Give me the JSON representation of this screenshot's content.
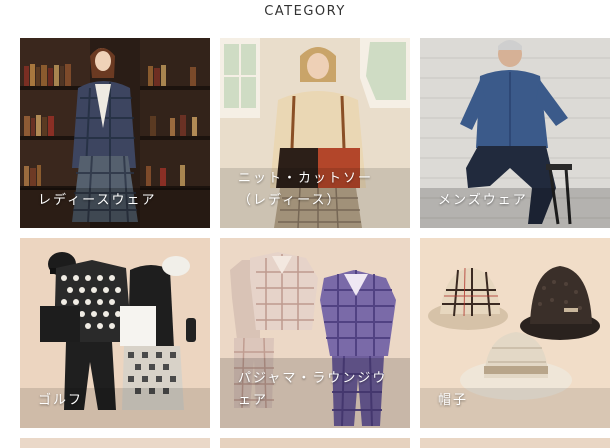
{
  "section": {
    "title": "CATEGORY"
  },
  "categories": [
    {
      "label": "レディースウェア"
    },
    {
      "label": "ニット・カットソー\n（レディース）"
    },
    {
      "label": "メンズウェア"
    },
    {
      "label": "ゴルフ"
    },
    {
      "label": "パジャマ・ラウンジウ\nェア"
    },
    {
      "label": "帽子"
    }
  ]
}
